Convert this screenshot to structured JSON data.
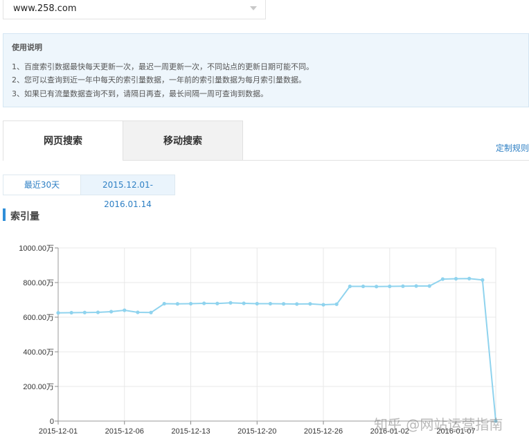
{
  "site_select": {
    "value": "www.258.com"
  },
  "notice": {
    "title": "使用说明",
    "lines": [
      "1、百度索引数据最快每天更新一次，最迟一周更新一次，不同站点的更新日期可能不同。",
      "2、您可以查询到近一年中每天的索引量数据，一年前的索引量数据为每月索引量数据。",
      "3、如果已有流量数据查询不到，请隔日再查，最长间隔一周可查询到数据。"
    ]
  },
  "tabs": [
    "网页搜索",
    "移动搜索"
  ],
  "custom_rule_link": "定制规则",
  "range_buttons": {
    "recent": "最近30天",
    "custom": "2015.12.01-2016.01.14"
  },
  "section_title": "索引量",
  "watermark": "知乎 @网站运营指南",
  "colors": {
    "line": "#8fd3ee",
    "accent": "#2f8ed8",
    "link": "#2d7fc4"
  },
  "chart_data": {
    "type": "line",
    "title": "",
    "xlabel": "",
    "ylabel": "",
    "ylim": [
      0,
      1000
    ],
    "grid": true,
    "y_ticks": [
      "0",
      "200.00万",
      "400.00万",
      "600.00万",
      "800.00万",
      "1000.00万"
    ],
    "x_tick_labels": [
      "2015-12-01",
      "2015-12-06",
      "2015-12-13",
      "2015-12-20",
      "2015-12-26",
      "2016-01-02",
      "2016-01-07"
    ],
    "x_tick_index": [
      0,
      5,
      10,
      15,
      20,
      25,
      30
    ],
    "series": [
      {
        "values": [
          625,
          626,
          627,
          628,
          632,
          640,
          628,
          627,
          678,
          677,
          678,
          680,
          679,
          683,
          680,
          678,
          678,
          677,
          676,
          677,
          672,
          675,
          778,
          778,
          777,
          778,
          779,
          780,
          780,
          820,
          822,
          823,
          815,
          0
        ]
      }
    ]
  }
}
